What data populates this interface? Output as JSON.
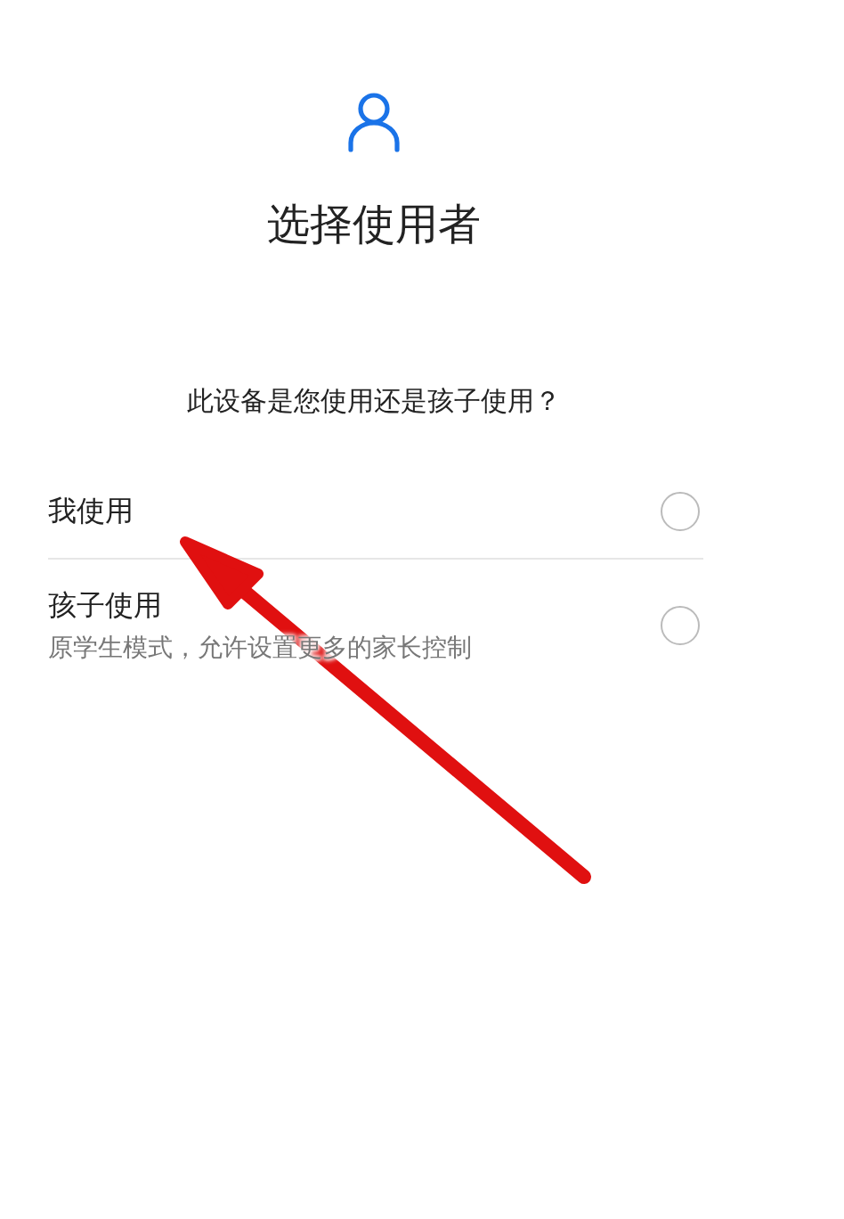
{
  "title": "选择使用者",
  "question": "此设备是您使用还是孩子使用？",
  "options": [
    {
      "label": "我使用",
      "selected": false
    },
    {
      "label": "孩子使用",
      "description": "原学生模式，允许设置更多的家长控制",
      "selected": false
    }
  ],
  "annotation": {
    "kind": "arrow"
  }
}
